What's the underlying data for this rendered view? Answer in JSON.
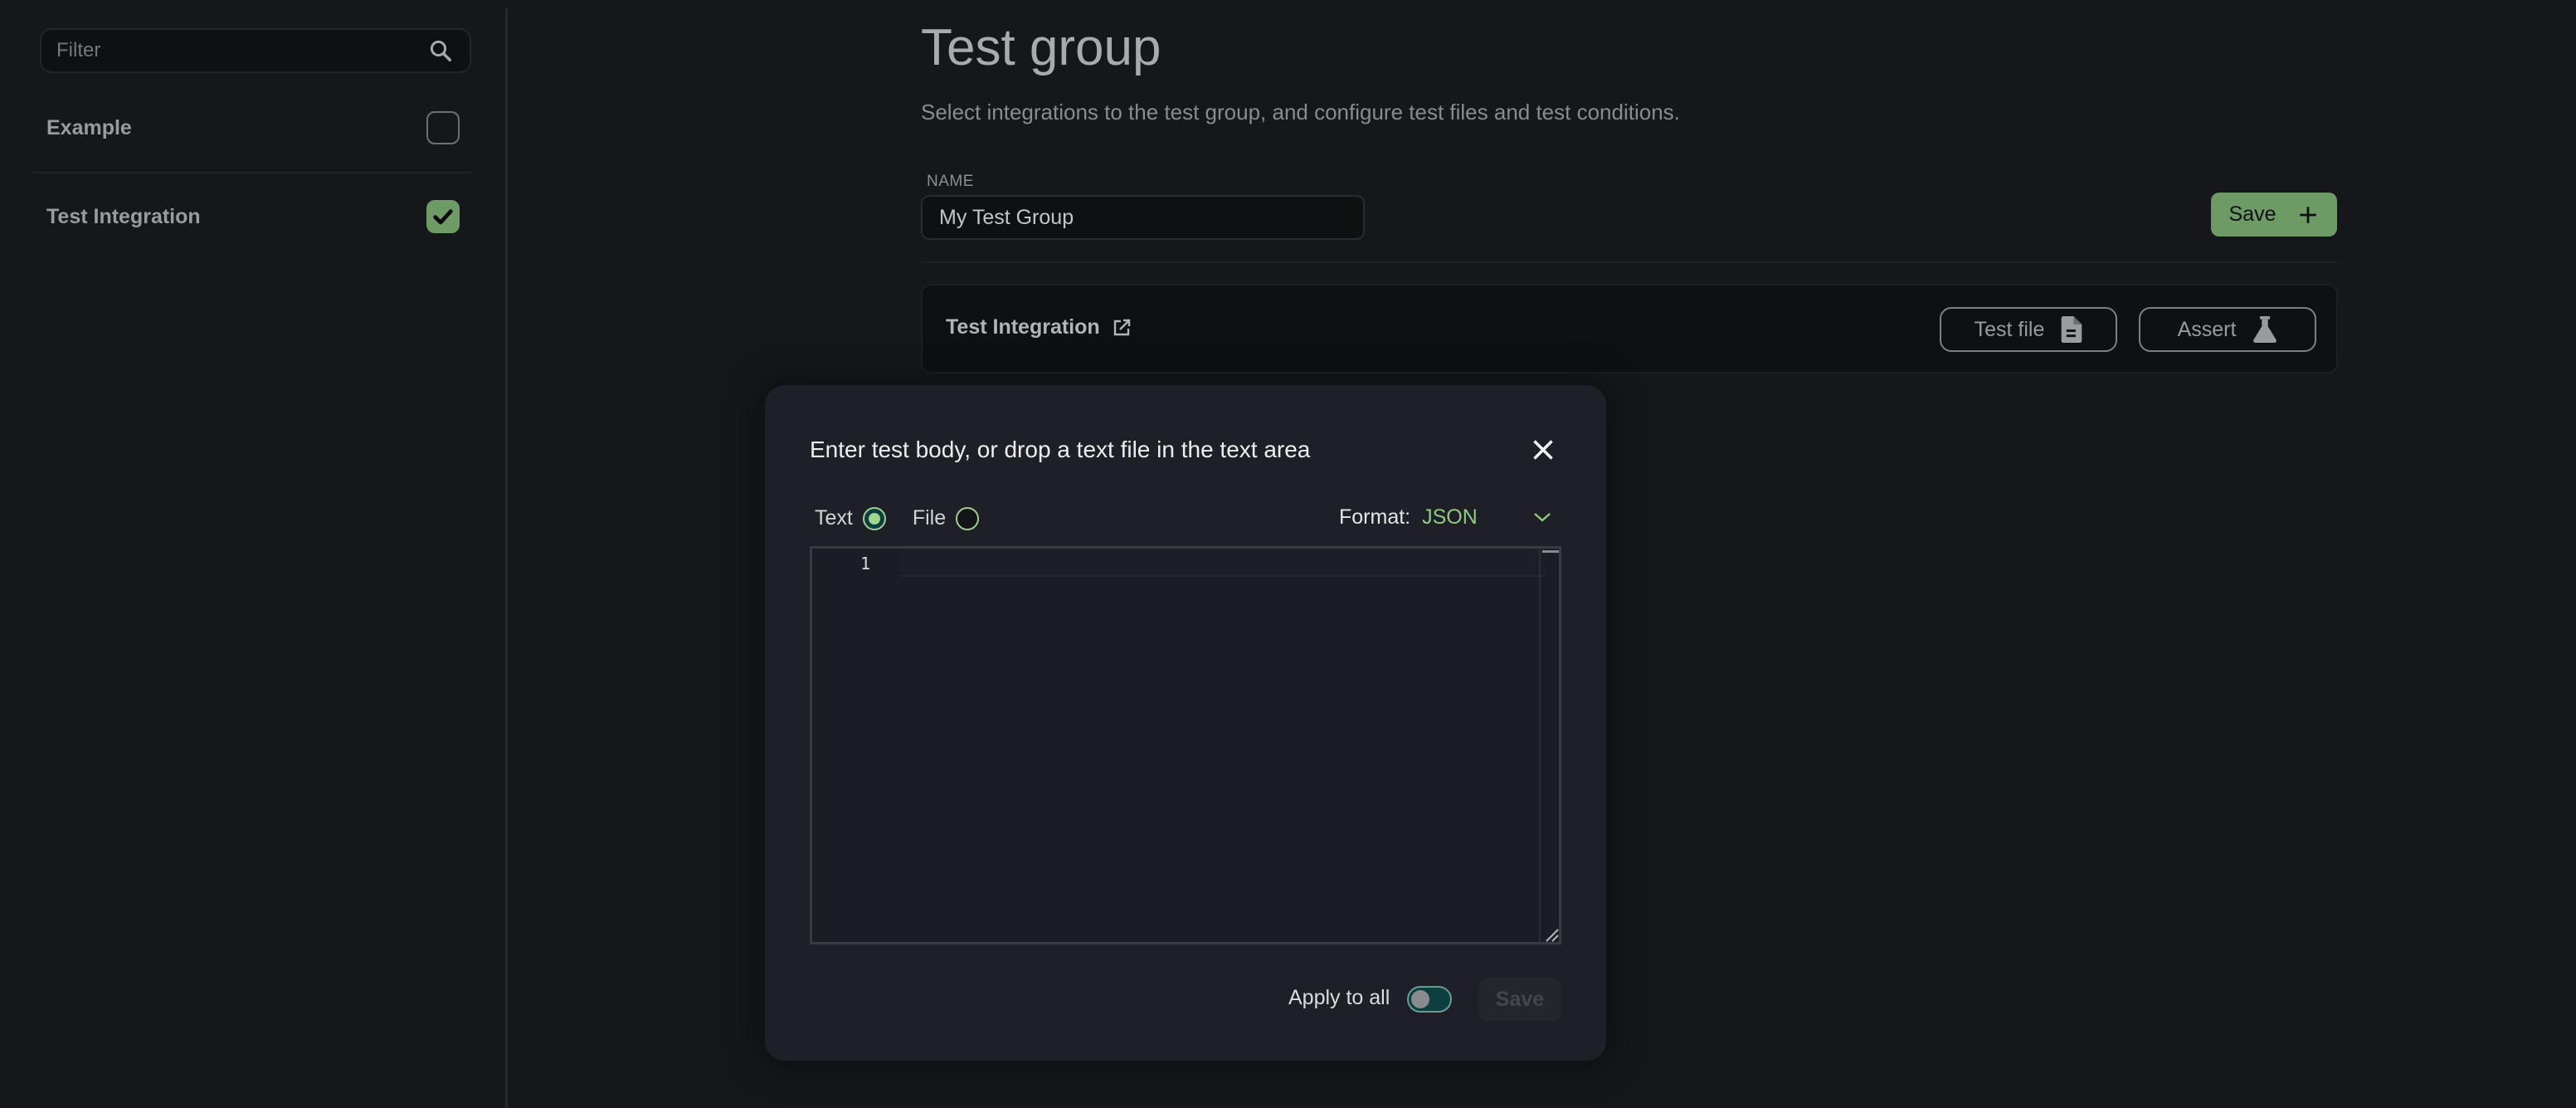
{
  "sidebar": {
    "filter": {
      "placeholder": "Filter",
      "value": "",
      "icon": "search-icon"
    },
    "items": [
      {
        "label": "Example",
        "checked": false
      },
      {
        "label": "Test Integration",
        "checked": true
      }
    ]
  },
  "main": {
    "title": "Test group",
    "subtitle": "Select integrations to the test group, and configure test files and test conditions.",
    "name_label": "NAME",
    "name_value": "My Test Group",
    "save_label": "Save",
    "save_icon": "plus-icon",
    "integration": {
      "name": "Test Integration",
      "link_icon": "external-link-icon",
      "test_file_label": "Test file",
      "test_file_icon": "file-icon",
      "assert_label": "Assert",
      "assert_icon": "flask-icon"
    }
  },
  "modal": {
    "title": "Enter test body, or drop a text file in the text area",
    "close_icon": "close-icon",
    "modes": [
      {
        "label": "Text",
        "selected": true
      },
      {
        "label": "File",
        "selected": false
      }
    ],
    "format_label": "Format:",
    "format_value": "JSON",
    "editor": {
      "line_numbers": [
        "1"
      ],
      "content": ""
    },
    "apply_to_all_label": "Apply to all",
    "apply_to_all_on": false,
    "save_label": "Save",
    "save_disabled": true
  },
  "colors": {
    "accent_green": "#6e9a66",
    "format_value": "#8fc982",
    "toggle_track": "#0e3f40",
    "background": "#16171b",
    "modal_bg": "#1f2027"
  }
}
